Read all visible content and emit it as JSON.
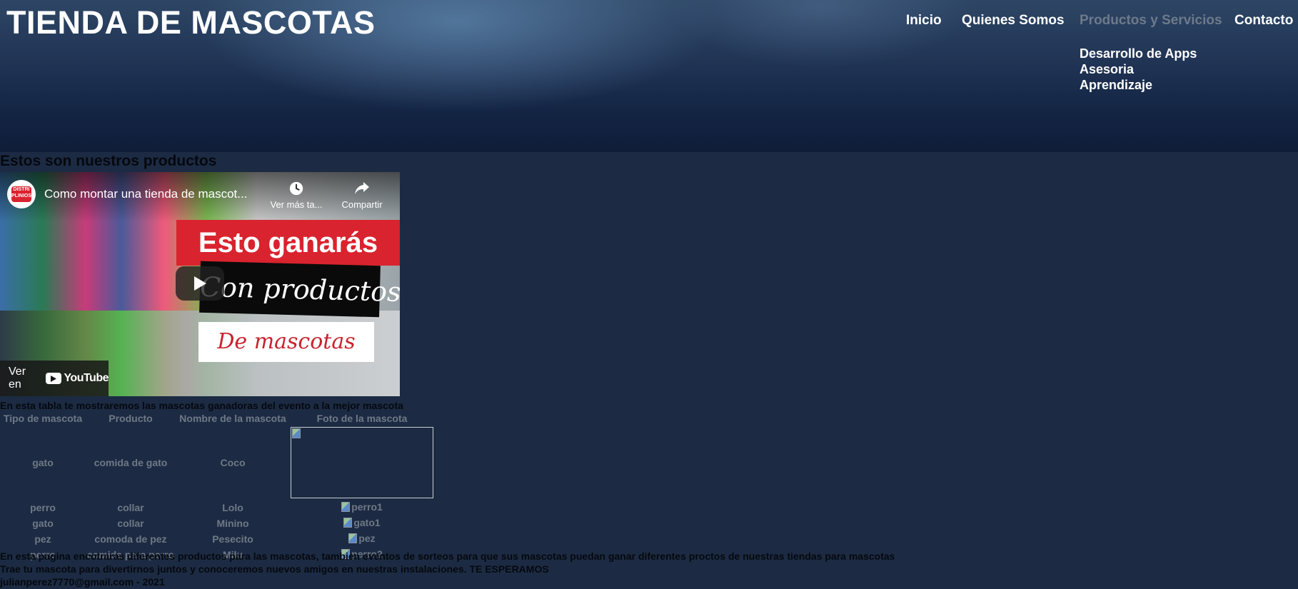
{
  "header": {
    "site_title": "TIENDA DE MASCOTAS",
    "nav": {
      "items": [
        {
          "label": "Inicio",
          "active": false
        },
        {
          "label": "Quienes Somos",
          "active": false
        },
        {
          "label": "Productos y Servicios",
          "active": true
        },
        {
          "label": "Contacto",
          "active": false
        }
      ],
      "submenu": [
        "Desarrollo de Apps",
        "Asesoria",
        "Aprendizaje"
      ]
    }
  },
  "main": {
    "section_title": "Estos son nuestros productos",
    "video": {
      "title": "Como montar una tienda de mascot...",
      "watch_later": "Ver más ta...",
      "share": "Compartir",
      "banner_line1": "Esto ganarás",
      "banner_line2": "Con productos",
      "banner_line3": "De mascotas",
      "watch_on": "Ver en",
      "youtube": "YouTube",
      "channel_logo_text": "DISTRI PLINIOS"
    },
    "table_caption": "En esta tabla te mostraremos las mascotas ganadoras del evento a la mejor mascota",
    "table": {
      "headers": [
        "Tipo de mascota",
        "Producto",
        "Nombre de la mascota",
        "Foto de la mascota"
      ],
      "rows": [
        {
          "tipo": "gato",
          "producto": "comida de gato",
          "nombre": "Coco",
          "foto_alt": ""
        },
        {
          "tipo": "perro",
          "producto": "collar",
          "nombre": "Lolo",
          "foto_alt": "perro1"
        },
        {
          "tipo": "gato",
          "producto": "collar",
          "nombre": "Minino",
          "foto_alt": "gato1"
        },
        {
          "tipo": "pez",
          "producto": "comoda de pez",
          "nombre": "Pesecito",
          "foto_alt": "pez"
        },
        {
          "tipo": "perro",
          "producto": "comida para perro",
          "nombre": "Milu",
          "foto_alt": "perro2"
        }
      ]
    },
    "paragraph1": "En esta pagina encotraras diferentes productos para las mascotas, tambien eventos de sorteos para que sus mascotas puedan ganar diferentes proctos de nuestras tiendas para mascotas",
    "paragraph2": "Trae tu mascota para divertirnos juntos y conoceremos nuevos amigos en nuestras instalaciones. TE ESPERAMOS"
  },
  "footer": {
    "text": "julianperez7770@gmail.com - 2021"
  },
  "colors": {
    "background": "#1c2b43",
    "nav_active": "#6d7a8b",
    "table_text": "#6f7886",
    "dark_text": "#05080e",
    "youtube_red": "#ff0000"
  }
}
